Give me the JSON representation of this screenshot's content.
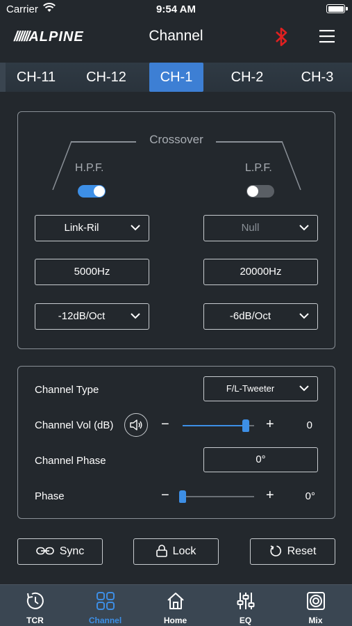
{
  "status_bar": {
    "carrier": "Carrier",
    "time": "9:54 AM"
  },
  "header": {
    "logo": "ALPINE",
    "title": "Channel",
    "bluetooth_color": "#e02020"
  },
  "channel_tabs": [
    {
      "label": "CH-11",
      "active": false
    },
    {
      "label": "CH-12",
      "active": false
    },
    {
      "label": "CH-1",
      "active": true
    },
    {
      "label": "CH-2",
      "active": false
    },
    {
      "label": "CH-3",
      "active": false
    }
  ],
  "crossover": {
    "title": "Crossover",
    "hpf": {
      "label": "H.P.F.",
      "enabled": true,
      "filter_type": "Link-Ril",
      "frequency": "5000Hz",
      "slope": "-12dB/Oct"
    },
    "lpf": {
      "label": "L.P.F.",
      "enabled": false,
      "filter_type": "Null",
      "frequency": "20000Hz",
      "slope": "-6dB/Oct"
    }
  },
  "channel_settings": {
    "type_label": "Channel Type",
    "type_value": "F/L-Tweeter",
    "vol_label": "Channel Vol (dB)",
    "vol_minus": "−",
    "vol_plus": "+",
    "vol_value": "0",
    "vol_level": 0.88,
    "phase_label": "Channel Phase",
    "phase_value": "0°",
    "phase2_label": "Phase",
    "phase2_minus": "−",
    "phase2_plus": "+",
    "phase2_value": "0°",
    "phase2_level": 0.0
  },
  "actions": {
    "sync": "Sync",
    "lock": "Lock",
    "reset": "Reset"
  },
  "tab_bar": [
    {
      "label": "TCR",
      "icon": "clock-icon",
      "active": false
    },
    {
      "label": "Channel",
      "icon": "grid-icon",
      "active": true
    },
    {
      "label": "Home",
      "icon": "home-icon",
      "active": false
    },
    {
      "label": "EQ",
      "icon": "eq-sliders-icon",
      "active": false
    },
    {
      "label": "Mix",
      "icon": "speaker-icon",
      "active": false
    }
  ],
  "colors": {
    "accent": "#3d8fe6",
    "background": "#23282d"
  }
}
